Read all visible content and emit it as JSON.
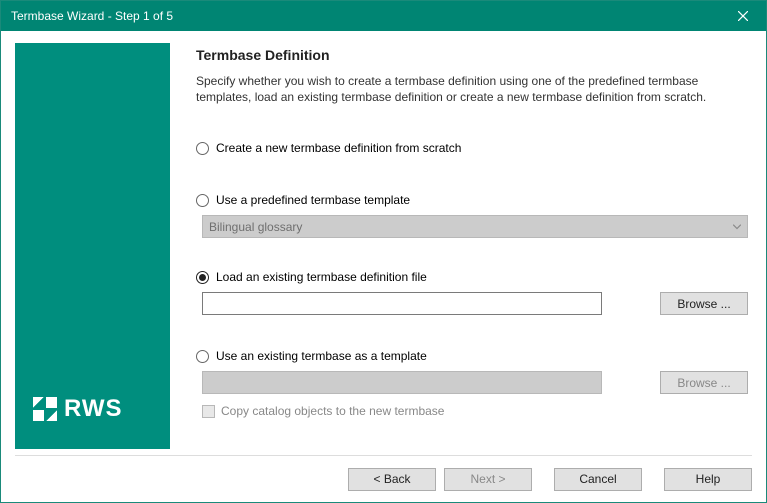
{
  "window": {
    "title": "Termbase Wizard - Step 1 of 5"
  },
  "logo": {
    "text": "RWS"
  },
  "heading": "Termbase Definition",
  "description": "Specify whether you wish to create a termbase definition using one of the predefined termbase templates, load an existing termbase definition or create a new termbase definition from scratch.",
  "options": {
    "create": {
      "label": "Create a new termbase definition from scratch"
    },
    "predefined": {
      "label": "Use a predefined termbase template",
      "combo_value": "Bilingual glossary"
    },
    "load": {
      "label": "Load an existing termbase definition file",
      "file_value": "",
      "browse_label": "Browse ..."
    },
    "existing": {
      "label": "Use an existing termbase as a template",
      "file_value": "",
      "browse_label": "Browse ...",
      "checkbox_label": "Copy catalog objects to the new termbase"
    }
  },
  "footer": {
    "back": "< Back",
    "next": "Next >",
    "cancel": "Cancel",
    "help": "Help"
  }
}
